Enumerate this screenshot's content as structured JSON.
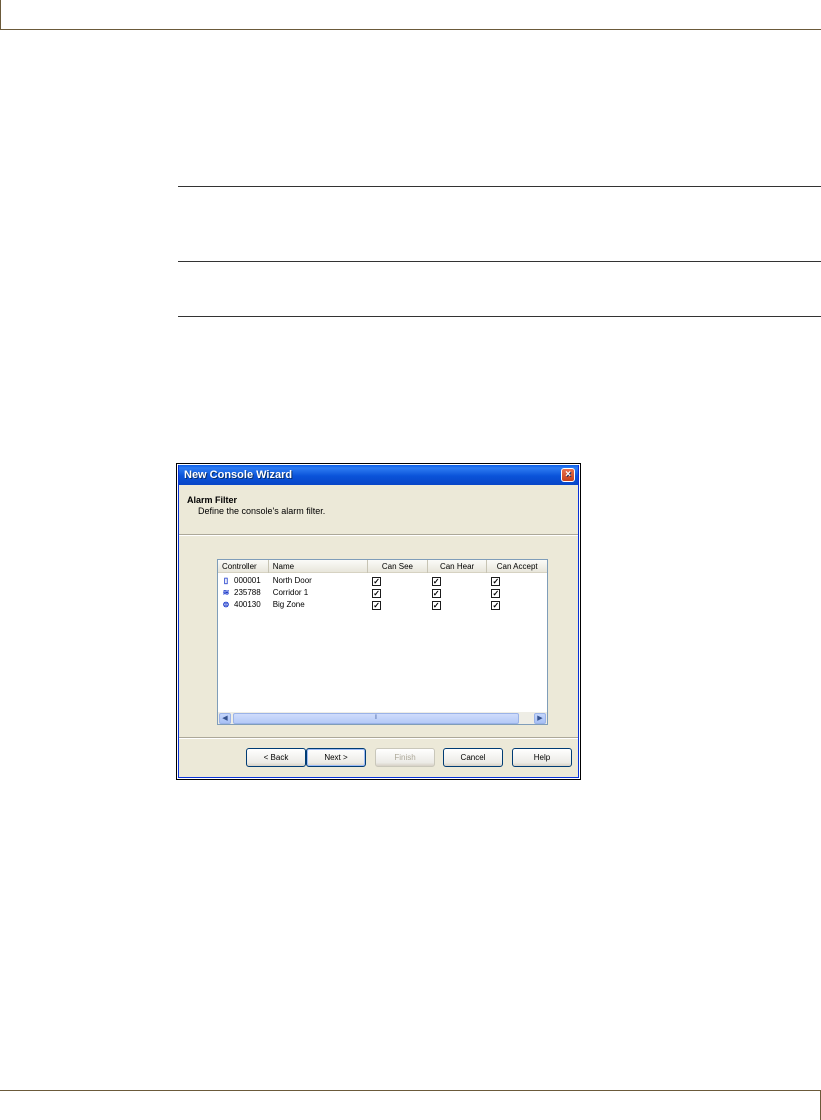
{
  "window": {
    "title": "New Console Wizard",
    "close_glyph": "×"
  },
  "header": {
    "title": "Alarm Filter",
    "subtitle": "Define the console's alarm filter."
  },
  "listview": {
    "columns": [
      "Controller",
      "Name",
      "Can See",
      "Can Hear",
      "Can Accept"
    ],
    "rows": [
      {
        "icon": "door-controller-icon",
        "controller": "000001",
        "name": "North Door",
        "can_see": true,
        "can_hear": true,
        "can_accept": true
      },
      {
        "icon": "corridor-controller-icon",
        "controller": "235788",
        "name": "Corridor 1",
        "can_see": true,
        "can_hear": true,
        "can_accept": true
      },
      {
        "icon": "zone-controller-icon",
        "controller": "400130",
        "name": "Big Zone",
        "can_see": true,
        "can_hear": true,
        "can_accept": true
      }
    ],
    "check_glyph": "✓",
    "scroll_left_glyph": "◀",
    "scroll_right_glyph": "▶",
    "scroll_grip": "⦀"
  },
  "buttons": {
    "back": "< Back",
    "next": "Next >",
    "finish": "Finish",
    "cancel": "Cancel",
    "help": "Help"
  },
  "colors": {
    "titlebar": "#0a53d9",
    "dialog_bg": "#ece9d8",
    "disabled_text": "#aca899"
  }
}
